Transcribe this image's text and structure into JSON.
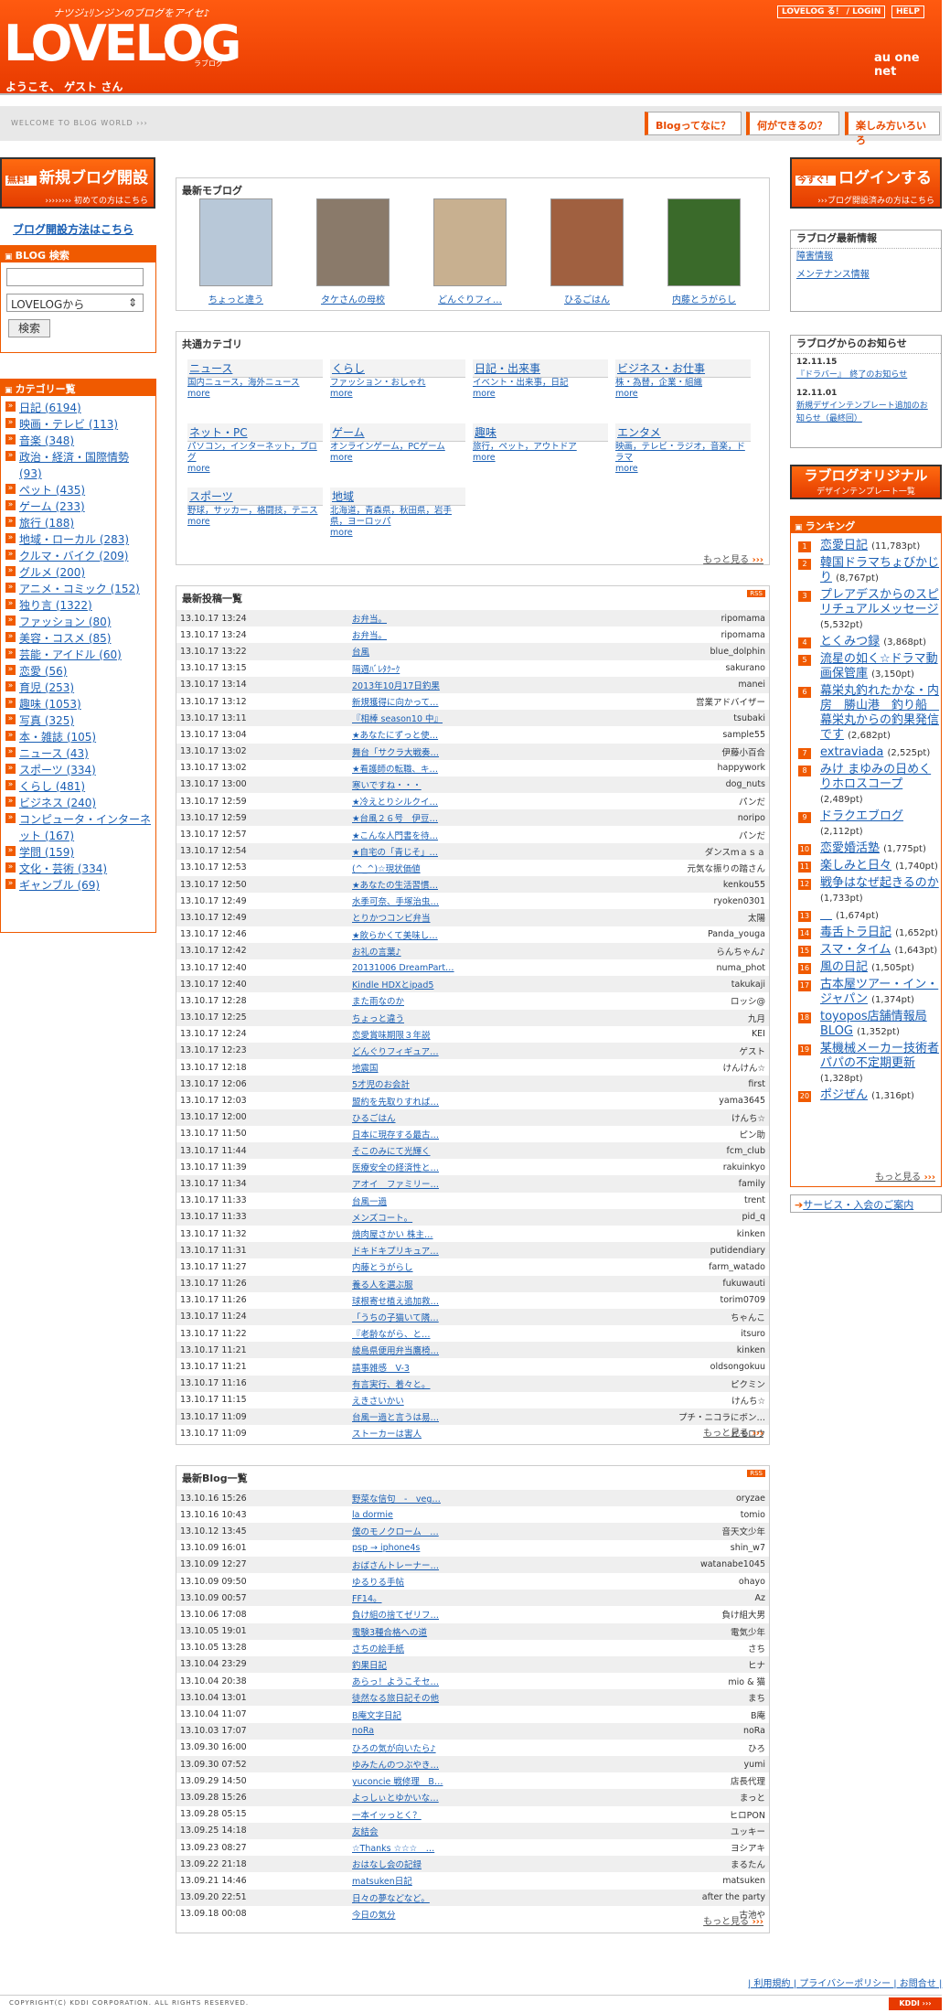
{
  "header": {
    "tagline": "ナツジｪﾘンジンのブログをアイセ♪",
    "logo": "LOVELOG",
    "logo_sub": "ラブログ",
    "welcome": "ようこそ、 ゲスト さん",
    "btn_login": "LOVELOG る！ / LOGIN",
    "btn_help": "HELP",
    "brand": "au one net"
  },
  "welcomebar": {
    "text": "WELCOME TO BLOG WORLD ›››",
    "btn1": "Blogってなに？",
    "btn2": "何ができるの？",
    "btn3": "楽しみ方いろいろ"
  },
  "left": {
    "promo_badge": "無料！",
    "promo_title": "新規ブログ開設",
    "promo_sub": "›››››››› 初めての方はこちら",
    "howto": "ブログ開設方法はこちら",
    "search_title": "BLOG 検索",
    "search_select": "LOVELOGから",
    "search_btn": "検索",
    "cat_title": "カテゴリー覧",
    "categories": [
      "日記 (6194)",
      "映画・テレビ (113)",
      "音楽 (348)",
      "政治・経済・国際情勢 (93)",
      "ペット (435)",
      "ゲーム (233)",
      "旅行 (188)",
      "地域・ローカル (283)",
      "クルマ・バイク (209)",
      "グルメ (200)",
      "アニメ・コミック (152)",
      "独り言 (1322)",
      "ファッション (80)",
      "美容・コスメ (85)",
      "芸能・アイドル (60)",
      "恋愛 (56)",
      "育児 (253)",
      "趣味 (1053)",
      "写真 (325)",
      "本・雑誌 (105)",
      "ニュース (43)",
      "スポーツ (334)",
      "くらし (481)",
      "ビジネス (240)",
      "コンピュータ・インターネット (167)",
      "学問 (159)",
      "文化・芸術 (334)",
      "ギャンブル (69)"
    ]
  },
  "newmo": {
    "title": "最新モブログ",
    "items": [
      "ちょっと違う",
      "タケさんの母校",
      "どんぐりフィ…",
      "ひるごはん",
      "内藤とうがらし"
    ]
  },
  "cats": {
    "title": "共通カテゴリ",
    "more": "もっと見る",
    "groups": [
      {
        "name": "ニュース",
        "links": "国内ニュース，海外ニュース",
        "more": "more"
      },
      {
        "name": "くらし",
        "links": "ファッション・おしゃれ",
        "more": "more"
      },
      {
        "name": "日記・出来事",
        "links": "イベント・出来事，日記",
        "more": "more"
      },
      {
        "name": "ビジネス・お仕事",
        "links": "株・為替，企業・組織",
        "more": "more"
      },
      {
        "name": "ネット・PC",
        "links": "パソコン，インターネット，ブログ",
        "more": "more"
      },
      {
        "name": "ゲーム",
        "links": "オンラインゲーム，PCゲーム",
        "more": "more"
      },
      {
        "name": "趣味",
        "links": "旅行，ペット，アウトドア",
        "more": "more"
      },
      {
        "name": "エンタメ",
        "links": "映画，テレビ・ラジオ，音楽，ドラマ",
        "more": "more"
      },
      {
        "name": "スポーツ",
        "links": "野球，サッカー，格闘技，テニス",
        "more": "more"
      },
      {
        "name": "地域",
        "links": "北海道，青森県，秋田県，岩手県，ヨーロッパ",
        "more": "more"
      }
    ]
  },
  "posts": {
    "title": "最新投稿一覧",
    "rss": "RSS",
    "more": "もっと見る",
    "rows": [
      [
        "13.10.17 13:24",
        "お弁当。",
        "ripomama"
      ],
      [
        "13.10.17 13:24",
        "お弁当。",
        "ripomama"
      ],
      [
        "13.10.17 13:22",
        "台風",
        "blue_dolphin"
      ],
      [
        "13.10.17 13:15",
        "隔週ﾊﾞﾚﾀｸｰｸ",
        "sakurano"
      ],
      [
        "13.10.17 13:14",
        "2013年10月17日釣果",
        "manei"
      ],
      [
        "13.10.17 13:12",
        "新規獲得に向かって…",
        "営業アドバイザー"
      ],
      [
        "13.10.17 13:11",
        "『相棒 season10 中』",
        "tsubaki"
      ],
      [
        "13.10.17 13:04",
        "★あなたにずっと使…",
        "sample55"
      ],
      [
        "13.10.17 13:02",
        "舞台「サクラ大戦奏…",
        "伊藤小百合"
      ],
      [
        "13.10.17 13:02",
        "★看護師の転職、キ…",
        "happywork"
      ],
      [
        "13.10.17 13:00",
        "寒いですね・・・",
        "dog_nuts"
      ],
      [
        "13.10.17 12:59",
        "★冷えとりシルクイ…",
        "パンだ"
      ],
      [
        "13.10.17 12:59",
        "★台風２６号　伊豆…",
        "noripo"
      ],
      [
        "13.10.17 12:57",
        "★こんな人門書を待…",
        "パンだ"
      ],
      [
        "13.10.17 12:54",
        "★自宅の「青じそ」…",
        "ダンスｍａｓａ"
      ],
      [
        "13.10.17 12:53",
        "(^_^)☆現状価値",
        "元気な振りの踏さん"
      ],
      [
        "13.10.17 12:50",
        "★あなたの生活習慣…",
        "kenkou55"
      ],
      [
        "13.10.17 12:49",
        "水季可奈、手塚治虫…",
        "ryoken0301"
      ],
      [
        "13.10.17 12:49",
        "とりかつコンビ弁当",
        "太陽"
      ],
      [
        "13.10.17 12:46",
        "★飲らかくて美味し…",
        "Panda_youga"
      ],
      [
        "13.10.17 12:42",
        "お礼の言葉♪",
        "らんちゃん♪"
      ],
      [
        "13.10.17 12:40",
        "20131006 DreamPart…",
        "numa_phot"
      ],
      [
        "13.10.17 12:40",
        "Kindle HDXとipad5",
        "takukaji"
      ],
      [
        "13.10.17 12:28",
        "また雨なのか",
        "ロッシ@"
      ],
      [
        "13.10.17 12:25",
        "ちょっと違う",
        "九月"
      ],
      [
        "13.10.17 12:24",
        "恋愛賞味期限３年説",
        "KEI"
      ],
      [
        "13.10.17 12:23",
        "どんぐりフィギュア…",
        "ゲスト"
      ],
      [
        "13.10.17 12:18",
        "地震国",
        "けんけん☆"
      ],
      [
        "13.10.17 12:06",
        "5才児のお会計",
        "first"
      ],
      [
        "13.10.17 12:03",
        "盟約を先取りすれば…",
        "yama3645"
      ],
      [
        "13.10.17 12:00",
        "ひるごはん",
        "けんち☆"
      ],
      [
        "13.10.17 11:50",
        "日本に現存する最古…",
        "ピン助"
      ],
      [
        "13.10.17 11:44",
        "そこのみにて光輝く",
        "fcm_club"
      ],
      [
        "13.10.17 11:39",
        "医療安全の経済性と…",
        "rakuinkyo"
      ],
      [
        "13.10.17 11:34",
        "アオイ　ファミリー…",
        "family"
      ],
      [
        "13.10.17 11:33",
        "台風一過",
        "trent"
      ],
      [
        "13.10.17 11:33",
        "メンズコート。",
        "pid_q"
      ],
      [
        "13.10.17 11:32",
        "焼肉屋さかい 株主…",
        "kinken"
      ],
      [
        "13.10.17 11:31",
        "ドキドキプリキュア…",
        "putidendiary"
      ],
      [
        "13.10.17 11:27",
        "内藤とうがらし",
        "farm_watado"
      ],
      [
        "13.10.17 11:26",
        "養る人を選ぶ服",
        "fukuwauti"
      ],
      [
        "13.10.17 11:26",
        "球根寄せ植え追加救…",
        "torim0709"
      ],
      [
        "13.10.17 11:24",
        "「うちの子猫いて隣…",
        "ちゃんこ"
      ],
      [
        "13.10.17 11:22",
        "『老齢ながら、と…",
        "itsuro"
      ],
      [
        "13.10.17 11:21",
        "綾島県便用弁当鷹椅…",
        "kinken"
      ],
      [
        "13.10.17 11:21",
        "請事雑感　V-3",
        "oldsongokuu"
      ],
      [
        "13.10.17 11:16",
        "有言実行、着々と。",
        "ピクミン"
      ],
      [
        "13.10.17 11:15",
        "えきさいかい",
        "けんち☆"
      ],
      [
        "13.10.17 11:09",
        "台風一過と言うは易…",
        "プチ・ニコラにボン…"
      ],
      [
        "13.10.17 11:09",
        "ストーカーは害人",
        "ピモロウ"
      ]
    ]
  },
  "blogs": {
    "title": "最新Blog一覧",
    "rss": "RSS",
    "more": "もっと見る",
    "rows": [
      [
        "13.10.16 15:26",
        "野菜な信句　-　veg…",
        "oryzae"
      ],
      [
        "13.10.16 10:43",
        "la dormie",
        "tomio"
      ],
      [
        "13.10.12 13:45",
        "僕のモノクローム　…",
        "音天文少年"
      ],
      [
        "13.10.09 16:01",
        "psp → iphone4s",
        "shin_w7"
      ],
      [
        "13.10.09 12:27",
        "おばさんトレーナー…",
        "watanabe1045"
      ],
      [
        "13.10.09 09:50",
        "ゆるりる手帖",
        "ohayo"
      ],
      [
        "13.10.09 00:57",
        "FF14。",
        "Az"
      ],
      [
        "13.10.06 17:08",
        "負け組の捨てゼリフ…",
        "負け組大男"
      ],
      [
        "13.10.05 19:01",
        "電験3種合格への道",
        "電気少年"
      ],
      [
        "13.10.05 13:28",
        "さちの絵手紙",
        "さち"
      ],
      [
        "13.10.04 23:29",
        "釣果日記",
        "ヒナ"
      ],
      [
        "13.10.04 20:38",
        "あらっ！ようこそセ…",
        "mio & 猫"
      ],
      [
        "13.10.04 13:01",
        "徒然なる旅日記その他",
        "まち"
      ],
      [
        "13.10.04 11:07",
        "B庵文字日記",
        "B庵"
      ],
      [
        "13.10.03 17:07",
        "noRa",
        "noRa"
      ],
      [
        "13.09.30 16:00",
        "ひろの気が向いたら♪",
        "ひろ"
      ],
      [
        "13.09.30 07:52",
        "ゆみたんのつぶやき…",
        "yumi"
      ],
      [
        "13.09.29 14:50",
        "yuconcie 戦修理　B…",
        "店長代理"
      ],
      [
        "13.09.28 15:26",
        "よっしぃとゆかいな…",
        "まっと"
      ],
      [
        "13.09.28 05:15",
        "一本イッっとく？",
        "ヒロPON"
      ],
      [
        "13.09.25 14:18",
        "友結会",
        "ユッキー"
      ],
      [
        "13.09.23 08:27",
        "☆Thanks ☆☆☆　…",
        "ヨシアキ"
      ],
      [
        "13.09.22 21:18",
        "おはなし会の記録",
        "まるたん"
      ],
      [
        "13.09.21 14:46",
        "matsuken日記",
        "matsuken"
      ],
      [
        "13.09.20 22:51",
        "日々の夢などなど。",
        "after the party"
      ],
      [
        "13.09.18 00:08",
        "今日の気分",
        "古池や"
      ]
    ]
  },
  "right": {
    "login_badge": "今すぐ！",
    "login_title": "ログインする",
    "login_sub": "›››ブログ開設済みの方はこちら",
    "info_title": "ラブログ最新情報",
    "info_links": [
      "障害情報",
      "メンテナンス情報"
    ],
    "notice_title": "ラブログからのお知らせ",
    "notices": [
      {
        "date": "12.11.15",
        "text": "『ドラバー』　終了のお知らせ"
      },
      {
        "date": "12.11.01",
        "text": "新規デザインテンプレート追加のお知らせ（最終回）"
      }
    ],
    "tmpl_title": "ラブログオリジナル",
    "tmpl_sub": "デザインテンプレート一覧",
    "rank_title": "ランキング",
    "rank_more": "もっと見る",
    "svc": "サービス・入会のご案内",
    "ranking": [
      [
        "恋愛日記",
        "(11,783pt)"
      ],
      [
        "韓国ドラマちょびかじり",
        "(8,767pt)"
      ],
      [
        "プレアデスからのスピリチュアルメッセージ",
        "(5,532pt)"
      ],
      [
        "とくみつ録",
        "(3,868pt)"
      ],
      [
        "流星の如く☆ドラマ動画保管庫",
        "(3,150pt)"
      ],
      [
        "幕栄丸釣れたかな・内房　勝山港　釣り船　幕栄丸からの釣果発信です",
        "(2,682pt)"
      ],
      [
        "extraviada",
        "(2,525pt)"
      ],
      [
        "みけ まゆみの日めくりホロスコープ",
        "(2,489pt)"
      ],
      [
        "ドラクエブログ",
        "(2,112pt)"
      ],
      [
        "恋愛婚活塾",
        "(1,775pt)"
      ],
      [
        "楽しみと日々",
        "(1,740pt)"
      ],
      [
        "戦争はなぜ起きるのか",
        "(1,733pt)"
      ],
      [
        "＿",
        "(1,674pt)"
      ],
      [
        "毒舌トラ日記",
        "(1,652pt)"
      ],
      [
        "スマ・タイム",
        "(1,643pt)"
      ],
      [
        "風の日記",
        "(1,505pt)"
      ],
      [
        "古本屋ツアー・イン・ジャパン",
        "(1,374pt)"
      ],
      [
        "toyopos店舗情報局BLOG",
        "(1,352pt)"
      ],
      [
        "某機械メーカー技術者パパの不定期更新",
        "(1,328pt)"
      ],
      [
        "ポジぜん",
        "(1,316pt)"
      ]
    ]
  },
  "footer": {
    "links": "| 利用規約 | プライバシーポリシー | お問合せ |",
    "copy": "COPYRIGHT(C) KDDI CORPORATION. ALL RIGHTS RESERVED.",
    "kddi": "KDDI ›››"
  }
}
